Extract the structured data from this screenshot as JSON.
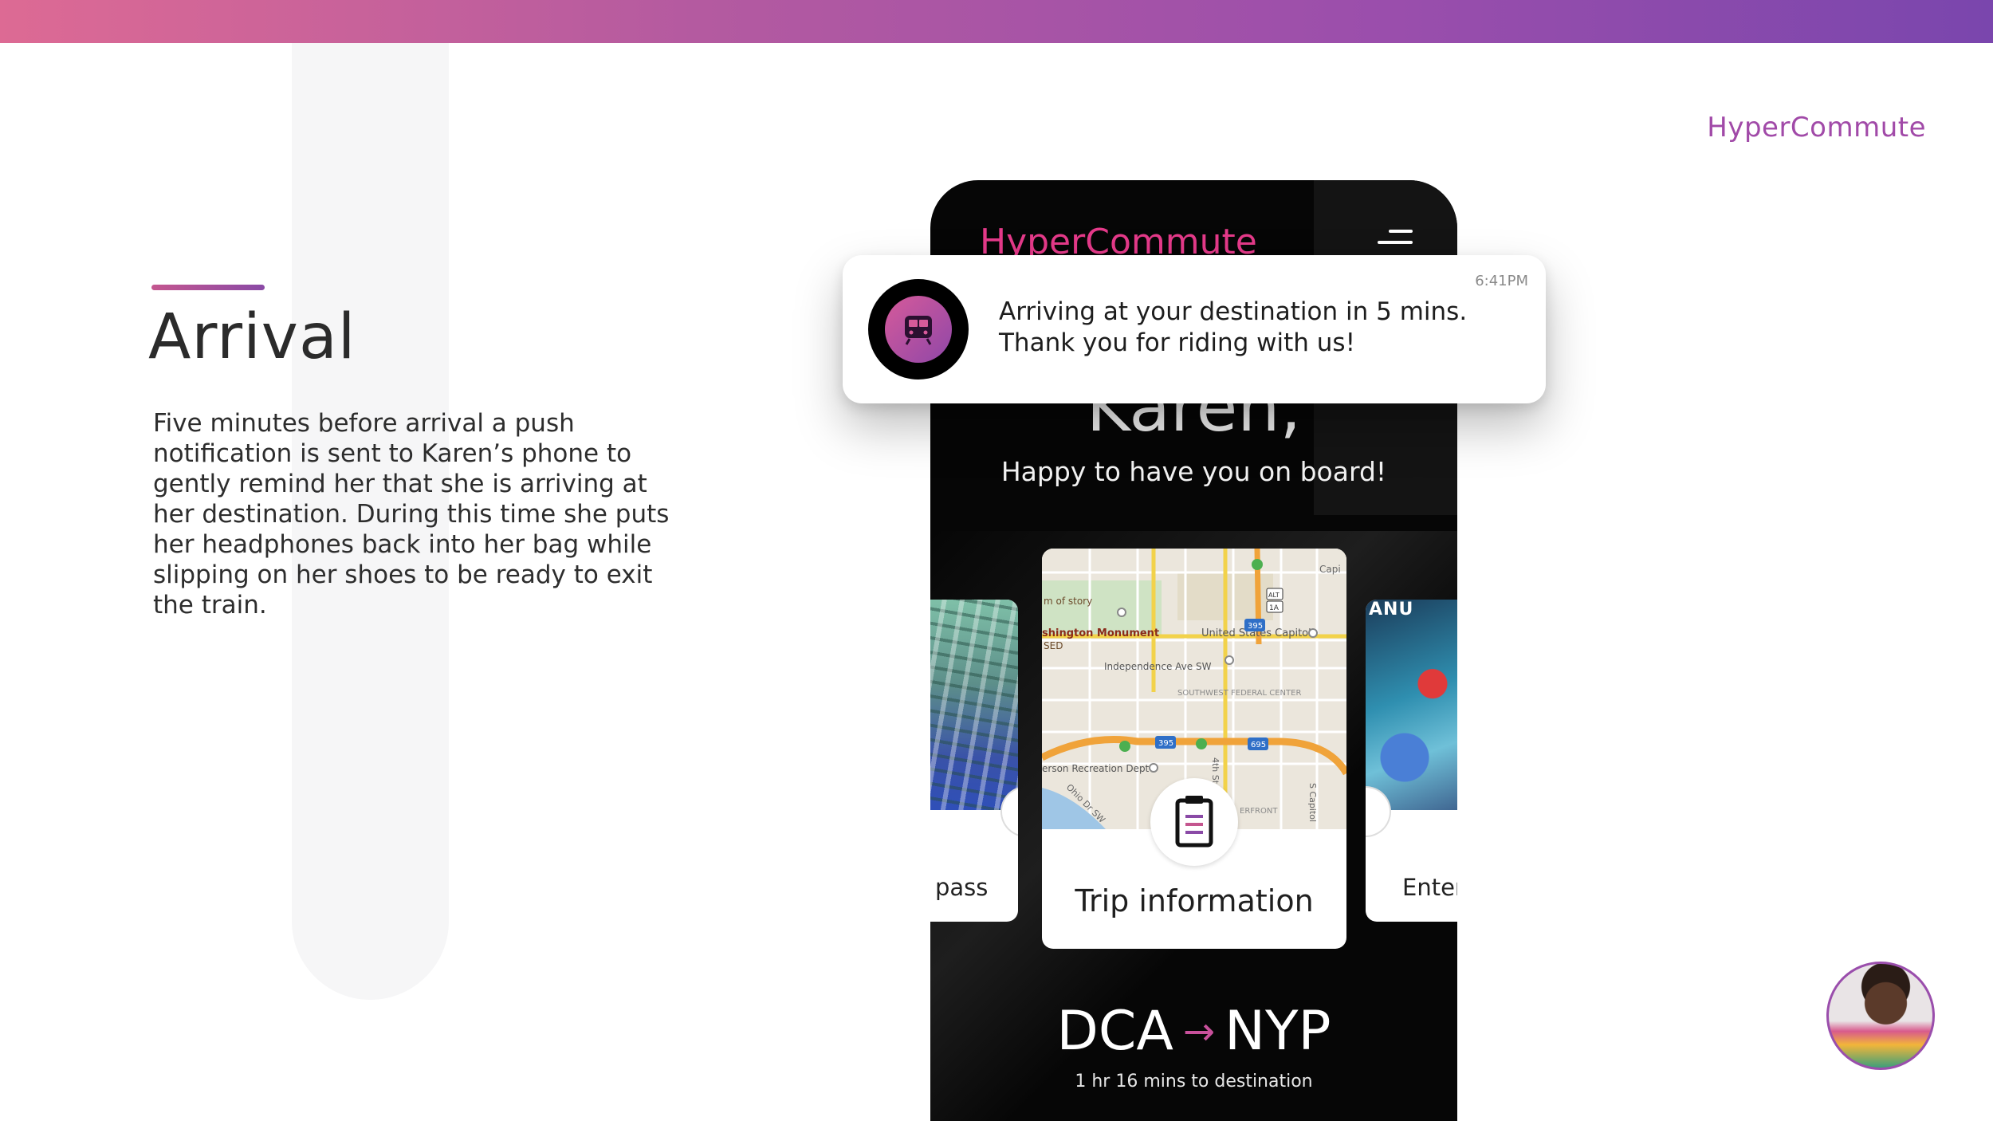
{
  "header": {
    "brand": "HyperCommute"
  },
  "section": {
    "title": "Arrival",
    "description": "Five minutes before arrival a push notification is sent to Karen’s phone to gently remind her that she is arriving at her destination. During this time she puts her headphones back into her bag while slipping on her shoes to be ready to exit the train."
  },
  "phone": {
    "brand": "HyperCommute",
    "greeting_name": "Karen,",
    "greeting_sub": "Happy to have you on board!",
    "cards": {
      "left_label": "pass",
      "center_label": "Trip information",
      "right_label": "Enter",
      "right_image_text": "ANU"
    },
    "map_labels": {
      "monument": "shington Monument",
      "capitol": "United States Capitol",
      "avenue": "Independence Ave SW",
      "district": "SOUTHWEST FEDERAL CENTER",
      "recreation": "erson Recreation Dept",
      "history": "m of story",
      "sed": "SED",
      "capi": "Capi",
      "waterfront": "ERFRONT",
      "street4": "4th St",
      "scapitol": "S Capitol",
      "ohio": "Ohio Dr SW",
      "hwy395a": "395",
      "hwy395b": "395",
      "hwy695": "695",
      "hwy1a": "1A",
      "alt": "ALT"
    },
    "route": {
      "origin": "DCA",
      "destination": "NYP",
      "time_to_destination": "1 hr 16 mins to destination"
    }
  },
  "notification": {
    "time": "6:41PM",
    "line1": "Arriving at your destination in 5 mins.",
    "line2": "Thank you for riding with us!"
  },
  "colors": {
    "accent_pink": "#e53a8a",
    "accent_purple": "#8a4aa6"
  }
}
